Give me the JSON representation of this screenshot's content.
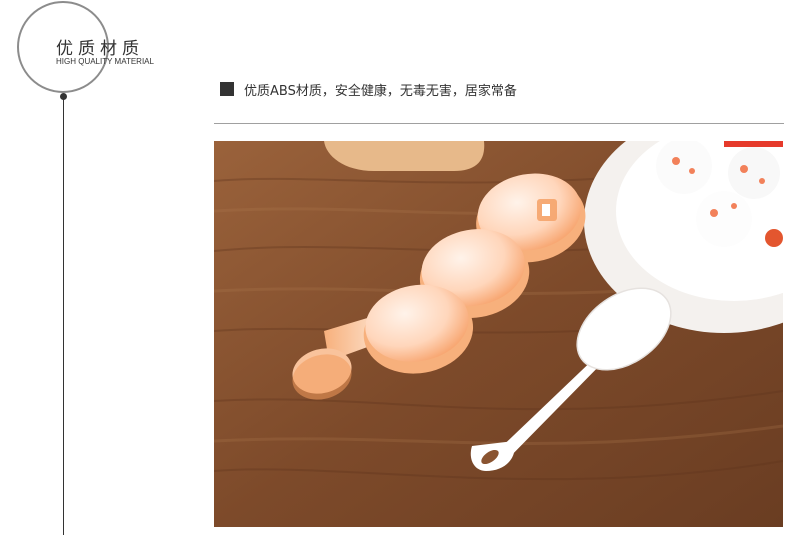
{
  "header": {
    "title": "优质材质",
    "subtitle": "HIGH QUALITY MATERIAL"
  },
  "feature": {
    "text": "优质ABS材质，安全健康，无毒无害，居家常备"
  },
  "photo": {
    "subject": "product-photo-rice-ball-mold-with-spoon"
  },
  "colors": {
    "accent": "#333333",
    "wood": "#8a5431",
    "mold": "#f7a26b"
  }
}
